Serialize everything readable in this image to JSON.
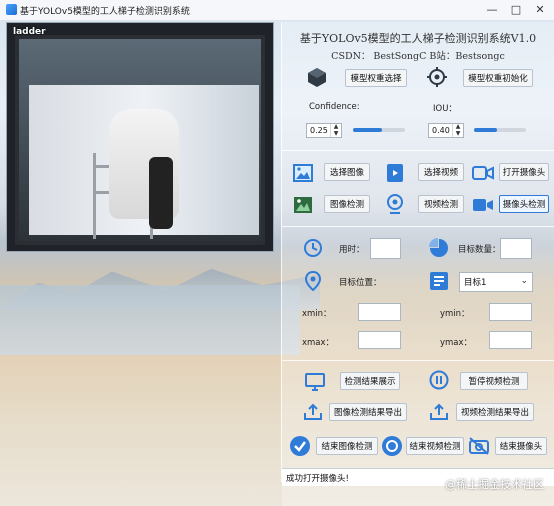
{
  "window": {
    "title": "基于YOLOv5模型的工人梯子检测识别系统"
  },
  "camera": {
    "overlay_label": "ladder"
  },
  "header": {
    "title": "基于YOLOv5模型的工人梯子检测识别系统V1.0",
    "subtitle": "CSDN：   BestSongC    B站：Bestsongc"
  },
  "model": {
    "select_btn": "模型权重选择",
    "init_btn": "模型权重初始化"
  },
  "params": {
    "confidence_label": "Confidence:",
    "confidence_value": "0.25",
    "iou_label": "IOU：",
    "iou_value": "0.40",
    "confidence_fill": 0.55,
    "iou_fill": 0.45
  },
  "io": {
    "select_image": "选择图像",
    "select_video": "选择视频",
    "open_camera": "打开摄像头",
    "detect_image": "图像检测",
    "detect_video": "视频检测",
    "detect_camera": "摄像头检测"
  },
  "results": {
    "time_label": "用时：",
    "count_label": "目标数量：",
    "pos_label": "目标位置：",
    "target_select": "目标1",
    "xmin_label": "xmin：",
    "ymin_label": "ymin：",
    "xmax_label": "xmax：",
    "ymax_label": "ymax："
  },
  "actions": {
    "show_result": "检测结果展示",
    "pause_video": "暂停视频检测",
    "export_image": "图像检测结果导出",
    "export_video": "视频检测结果导出",
    "end_image": "结束图像检测",
    "end_video": "结束视频检测",
    "end_camera": "结束摄像头"
  },
  "status": {
    "message": "成功打开摄像头!"
  },
  "watermark": "@稀土掘金技术社区",
  "colors": {
    "accent": "#2f7bd8"
  }
}
